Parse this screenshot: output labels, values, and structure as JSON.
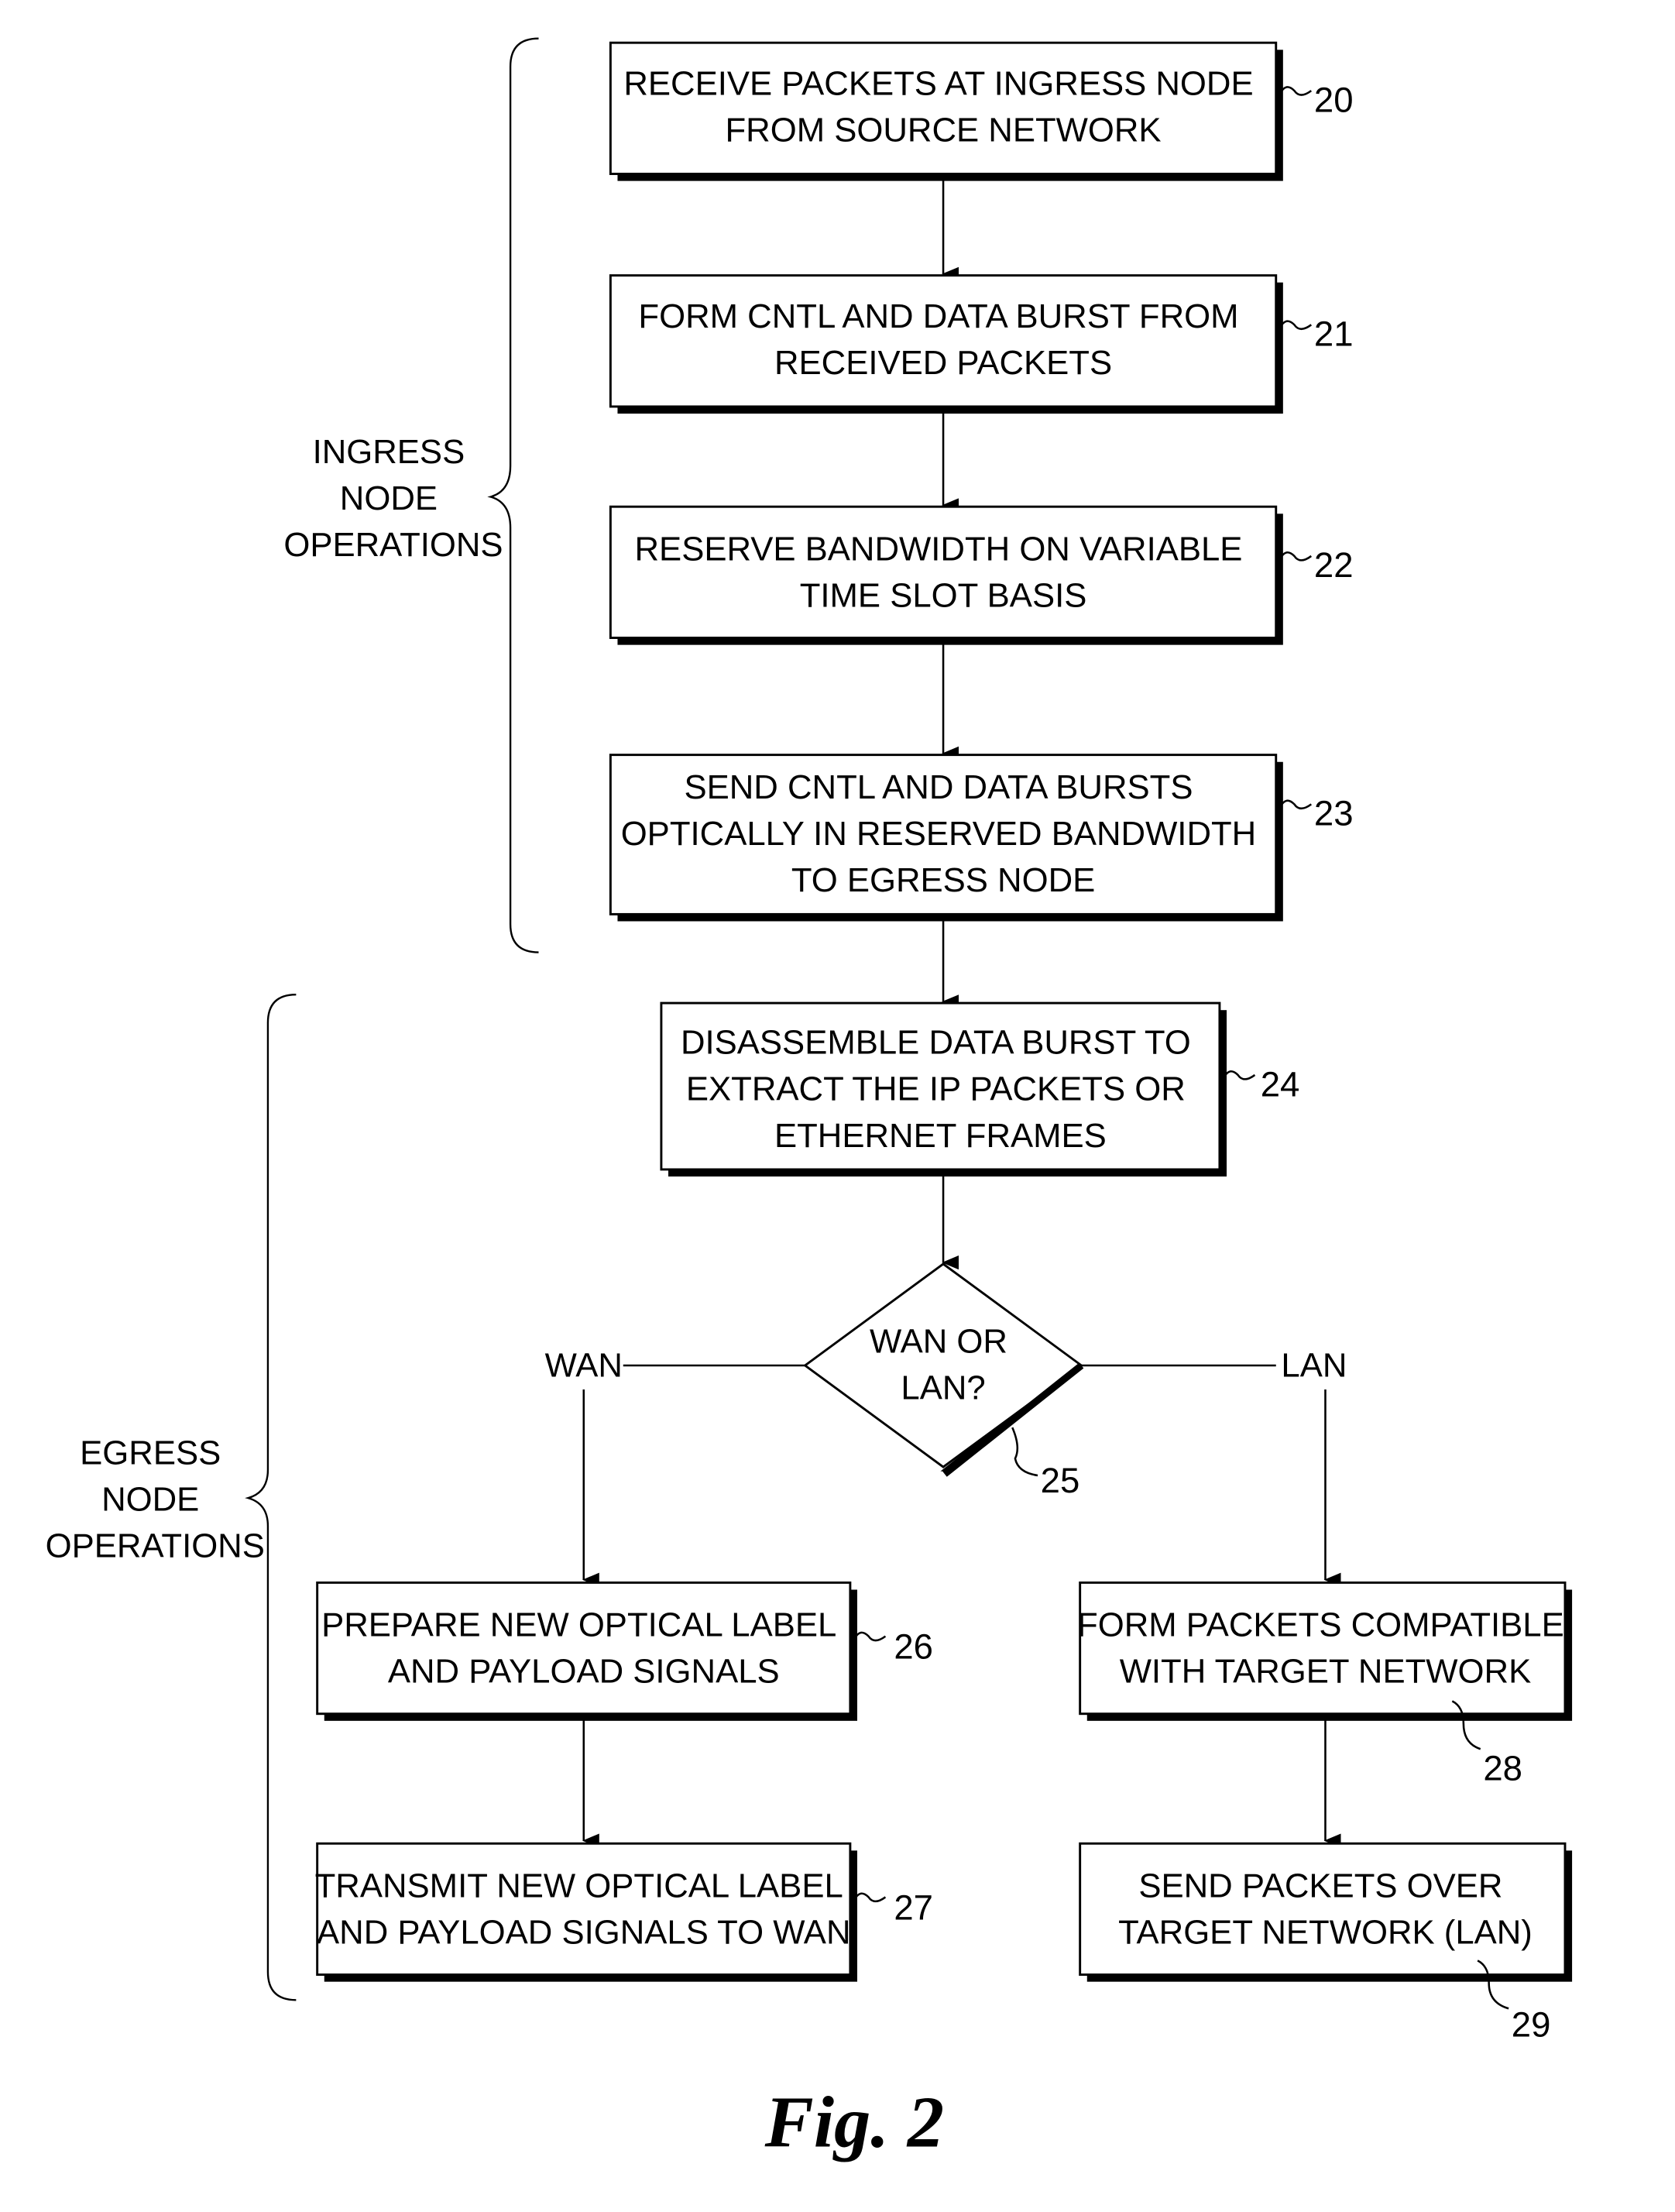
{
  "figure_label": "Fig. 2",
  "groups": {
    "ingress": [
      "INGRESS",
      "NODE",
      "OPERATIONS"
    ],
    "egress": [
      "EGRESS",
      "NODE",
      "OPERATIONS"
    ]
  },
  "steps": [
    {
      "ref": "20",
      "lines": [
        "RECEIVE PACKETS AT INGRESS NODE",
        "FROM SOURCE NETWORK"
      ]
    },
    {
      "ref": "21",
      "lines": [
        "FORM CNTL AND DATA BURST FROM",
        "RECEIVED PACKETS"
      ]
    },
    {
      "ref": "22",
      "lines": [
        "RESERVE BANDWIDTH ON VARIABLE",
        "TIME SLOT BASIS"
      ]
    },
    {
      "ref": "23",
      "lines": [
        "SEND CNTL AND DATA BURSTS",
        "OPTICALLY IN RESERVED BANDWIDTH",
        "TO EGRESS NODE"
      ]
    },
    {
      "ref": "24",
      "lines": [
        "DISASSEMBLE DATA BURST TO",
        "EXTRACT THE IP PACKETS OR",
        "ETHERNET FRAMES"
      ]
    },
    {
      "ref": "26",
      "lines": [
        "PREPARE NEW OPTICAL LABEL",
        "AND PAYLOAD SIGNALS"
      ]
    },
    {
      "ref": "27",
      "lines": [
        "TRANSMIT NEW OPTICAL LABEL",
        "AND PAYLOAD SIGNALS TO WAN"
      ]
    },
    {
      "ref": "28",
      "lines": [
        "FORM PACKETS COMPATIBLE",
        "WITH TARGET NETWORK"
      ]
    },
    {
      "ref": "29",
      "lines": [
        "SEND PACKETS OVER",
        "TARGET NETWORK (LAN)"
      ]
    }
  ],
  "decision": {
    "ref": "25",
    "lines": [
      "WAN OR",
      "LAN?"
    ],
    "left_branch": "WAN",
    "right_branch": "LAN"
  }
}
